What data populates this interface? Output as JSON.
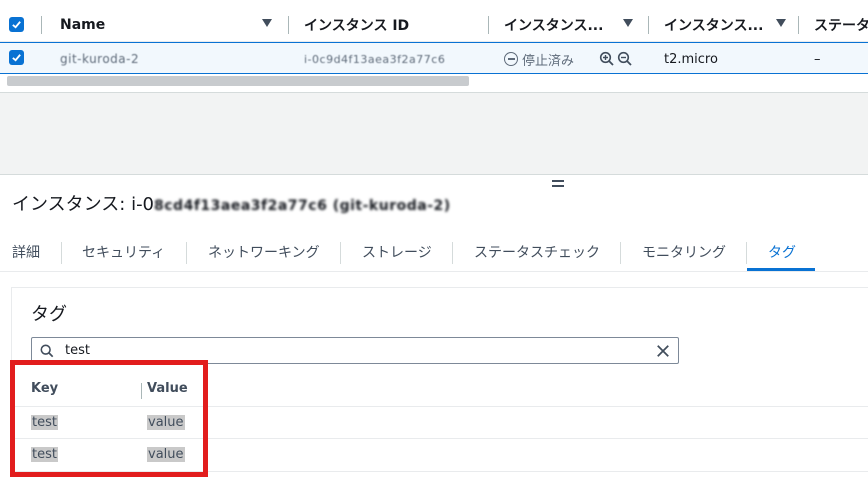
{
  "instances_table": {
    "columns": [
      {
        "label": "Name",
        "sortable": true
      },
      {
        "label": "インスタンス ID",
        "sortable": false
      },
      {
        "label": "インスタンス...",
        "sortable": true
      },
      {
        "label": "インスタンス...",
        "sortable": true
      },
      {
        "label": "ステータ",
        "sortable": false
      }
    ],
    "row": {
      "name": "git-kuroda-2",
      "instance_id": "i-0c9d4f13aea3f2a77c6",
      "state": "停止済み",
      "instance_type": "t2.micro",
      "status_check": "–"
    }
  },
  "details": {
    "title_prefix": "インスタンス: i-0",
    "title_redacted": "8cd4f13aea3f2a77c6 (git-kuroda-2)",
    "tabs": [
      "詳細",
      "セキュリティ",
      "ネットワーキング",
      "ストレージ",
      "ステータスチェック",
      "モニタリング",
      "タグ"
    ],
    "active_tab": "タグ"
  },
  "tags_panel": {
    "heading": "タグ",
    "search_value": "test",
    "columns": [
      "Key",
      "Value"
    ],
    "rows": [
      {
        "key": "test",
        "value": "value"
      },
      {
        "key": "test",
        "value": "value"
      }
    ]
  },
  "colors": {
    "accent": "#0972d3",
    "highlight_box": "#e21d1d",
    "selected_row": "#f2f8fd"
  },
  "icons": [
    "checkbox-checked-icon",
    "sort-caret-icon",
    "stopped-status-icon",
    "zoom-in-icon",
    "zoom-out-icon",
    "search-icon",
    "clear-icon",
    "drag-handle-icon"
  ]
}
